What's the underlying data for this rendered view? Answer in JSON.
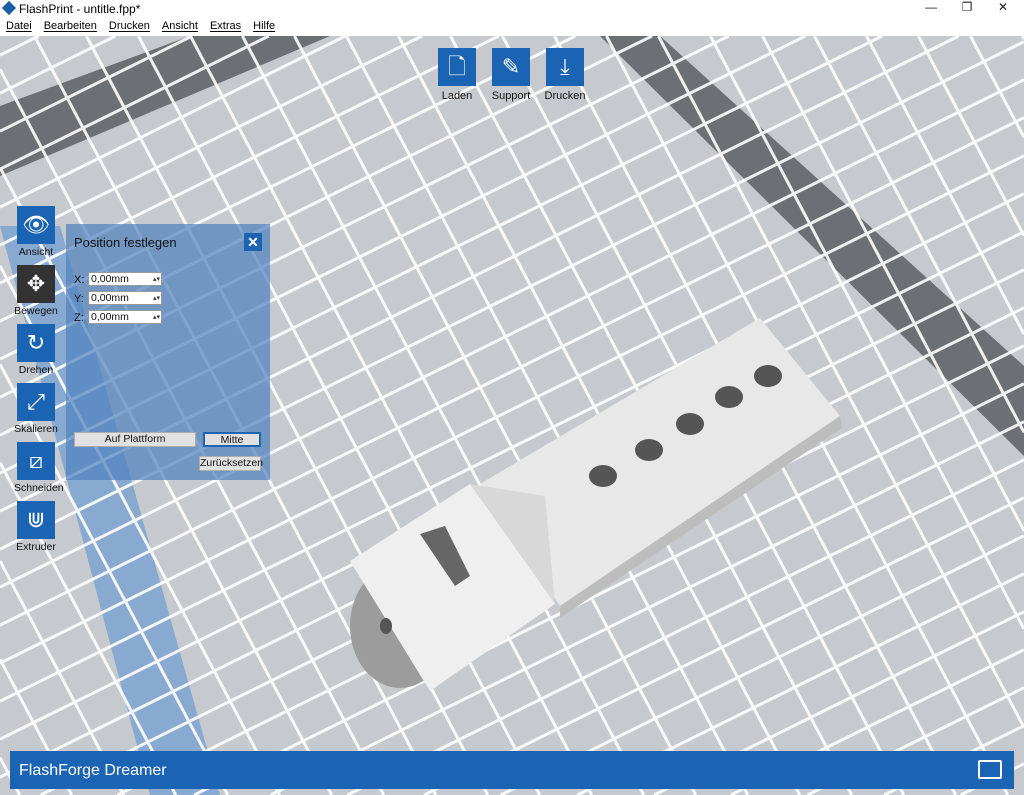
{
  "window": {
    "title": "FlashPrint - untitle.fpp*",
    "minimize": "—",
    "restore": "❐",
    "close": "✕"
  },
  "menu": [
    "Datei",
    "Bearbeiten",
    "Drucken",
    "Ansicht",
    "Extras",
    "Hilfe"
  ],
  "topbar": [
    {
      "label": "Laden",
      "icon": "load-file-icon"
    },
    {
      "label": "Support",
      "icon": "support-icon"
    },
    {
      "label": "Drucken",
      "icon": "print-icon"
    }
  ],
  "tools": [
    {
      "label": "Ansicht",
      "icon": "eye-icon"
    },
    {
      "label": "Bewegen",
      "icon": "move-icon"
    },
    {
      "label": "Drehen",
      "icon": "rotate-icon"
    },
    {
      "label": "Skalieren",
      "icon": "scale-icon"
    },
    {
      "label": "Schneiden",
      "icon": "cut-icon"
    },
    {
      "label": "Extruder",
      "icon": "extruder-icon"
    }
  ],
  "panel": {
    "title": "Position festlegen",
    "x_label": "X:",
    "x_value": "0,00mm",
    "y_label": "Y:",
    "y_value": "0,00mm",
    "z_label": "Z:",
    "z_value": "0,00mm",
    "on_platform": "Auf Plattform",
    "center": "Mitte",
    "reset": "Zurücksetzen"
  },
  "status": {
    "printer": "FlashForge Dreamer"
  },
  "colors": {
    "accent": "#1b63b3",
    "grid_bg": "#c6c9ce"
  }
}
